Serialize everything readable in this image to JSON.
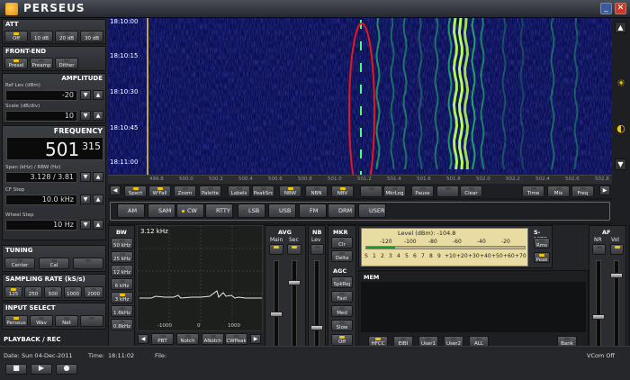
{
  "app": {
    "title": "PERSEUS",
    "minimize": "_",
    "close": "✕"
  },
  "att": {
    "title": "ATT",
    "buttons": [
      "Off",
      "10 dB",
      "20 dB",
      "30 dB"
    ]
  },
  "frontend": {
    "title": "FRONT-END",
    "buttons": [
      "Presel",
      "Preamp",
      "Dither"
    ]
  },
  "amplitude": {
    "title": "AMPLITUDE",
    "ref_label": "Ref Lev (dBm)",
    "ref_value": "-20",
    "scale_label": "Scale (dB/div)",
    "scale_value": "10"
  },
  "frequency": {
    "title": "FREQUENCY",
    "khz": "501",
    "hz": "315",
    "span_label": "Span (kHz) / RBW (Hz)",
    "span_value": "3.128 / 3.81",
    "cf_label": "CF Step",
    "cf_value": "10.0 kHz",
    "wheel_label": "Wheel Step",
    "wheel_value": "10 Hz"
  },
  "tuning": {
    "title": "TUNING",
    "buttons": [
      "Center",
      "Cal",
      ""
    ]
  },
  "sampling": {
    "title": "SAMPLING RATE (kS/s)",
    "buttons": [
      "125",
      "250",
      "500",
      "1000",
      "2000"
    ]
  },
  "input": {
    "title": "INPUT SELECT",
    "buttons": [
      "Perseus",
      "Wav",
      "Net",
      ""
    ]
  },
  "playback": {
    "title": "PLAYBACK / REC"
  },
  "waterfall": {
    "times": [
      "18:10:00",
      "18:10:15",
      "18:10:30",
      "18:10:45",
      "18:11:00"
    ]
  },
  "scale_ticks": [
    "499.8",
    "500.0",
    "500.2",
    "500.4",
    "500.6",
    "500.8",
    "501.0",
    "501.2",
    "501.4",
    "501.6",
    "501.8",
    "502.0",
    "502.2",
    "502.4",
    "502.6",
    "502.8"
  ],
  "toolbar": {
    "buttons": [
      "Spect",
      "W'Fall",
      "Zoom",
      "Palette",
      "Labels",
      "PeakSrc",
      "NBW",
      "NBN",
      "NBV",
      "",
      "MkrLog",
      "Pause",
      "",
      "Clear",
      "Time",
      "Mix",
      "Freq"
    ]
  },
  "modes": [
    "AM",
    "SAM",
    "CW",
    "RTTY",
    "LSB",
    "USB",
    "FM",
    "DRM",
    "USER"
  ],
  "bw": {
    "title": "BW",
    "buttons": [
      "50 kHz",
      "25 kHz",
      "12 kHz",
      "6 kHz",
      "3 kHz",
      "1.6kHz",
      "0.8kHz"
    ],
    "display": "3.12 kHz",
    "axis": [
      "-1000",
      "0",
      "1000"
    ]
  },
  "filter_buttons": [
    "PBT",
    "Notch",
    "ANotch",
    "CWPeak"
  ],
  "avg": {
    "title": "AVG",
    "main": "Main",
    "sec": "Sec"
  },
  "nb": {
    "title": "NB",
    "lev": "Lev"
  },
  "mkr": {
    "title": "MKR",
    "buttons": [
      "Clr",
      "Delta"
    ]
  },
  "agc": {
    "title": "AGC",
    "buttons": [
      "SpkRej",
      "Fast",
      "Med",
      "Slow",
      "Off"
    ]
  },
  "smeter": {
    "title": "S-MTR",
    "level": "Level (dBm): -104.8",
    "top": [
      "-120",
      "-100",
      "-80",
      "-60",
      "-40",
      "-20"
    ],
    "bottom": [
      "S",
      "1",
      "2",
      "3",
      "4",
      "5",
      "6",
      "7",
      "8",
      "9",
      "+10",
      "+20",
      "+30",
      "+40",
      "+50",
      "+60",
      "+70"
    ],
    "buttons": [
      "Rms",
      "Peak"
    ],
    "level_fraction": 0.18
  },
  "mem": {
    "title": "MEM",
    "buttons": [
      "HFCC",
      "EIBI",
      "User1",
      "User2",
      "ALL",
      "Bank"
    ]
  },
  "af": {
    "title": "AF",
    "nr": "NR",
    "vol": "Vol"
  },
  "status": {
    "date_label": "Date:",
    "date": "Sun 04-Dec-2011",
    "time_label": "Time:",
    "time": "18:11:02",
    "file_label": "File:",
    "vcom": "VCom Off"
  },
  "colors": {
    "waterfall_bg": "#0c0f55",
    "signal": "#2cff6a",
    "marker": "#e8151b",
    "led_on": "#f2c500",
    "meter_bg": "#e9dca2"
  }
}
